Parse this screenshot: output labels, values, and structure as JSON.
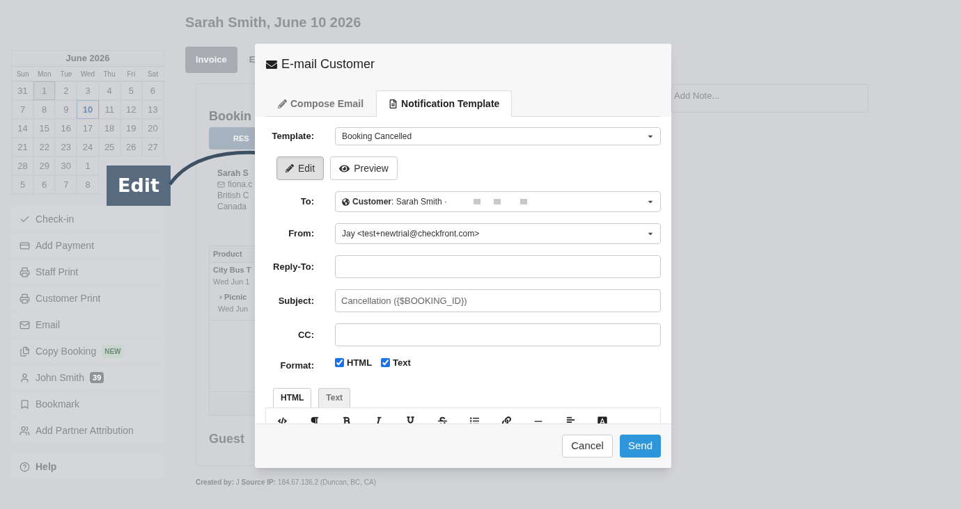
{
  "page": {
    "title": "Sarah Smith, June 10 2026",
    "tabs": [
      {
        "label": "Invoice",
        "selected": true
      },
      {
        "label": "E",
        "selected": false
      }
    ],
    "calendar": {
      "month": "June 2026",
      "weekdays": [
        "Sun",
        "Mon",
        "Tue",
        "Wed",
        "Thu",
        "Fri",
        "Sat"
      ],
      "weeks": [
        [
          {
            "day": "31",
            "selected": false,
            "today": false
          },
          {
            "day": "1",
            "selected": false,
            "today": true
          },
          {
            "day": "2",
            "selected": false,
            "today": false
          },
          {
            "day": "3",
            "selected": false,
            "today": false
          },
          {
            "day": "4",
            "selected": false,
            "today": false
          },
          {
            "day": "5",
            "selected": false,
            "today": false
          },
          {
            "day": "6",
            "selected": false,
            "today": false
          }
        ],
        [
          {
            "day": "7",
            "selected": false,
            "today": false
          },
          {
            "day": "8",
            "selected": false,
            "today": false
          },
          {
            "day": "9",
            "selected": false,
            "today": false
          },
          {
            "day": "10",
            "selected": true,
            "today": false
          },
          {
            "day": "11",
            "selected": false,
            "today": false
          },
          {
            "day": "12",
            "selected": false,
            "today": false
          },
          {
            "day": "13",
            "selected": false,
            "today": false
          }
        ],
        [
          {
            "day": "14",
            "selected": false,
            "today": false
          },
          {
            "day": "15",
            "selected": false,
            "today": false
          },
          {
            "day": "16",
            "selected": false,
            "today": false
          },
          {
            "day": "17",
            "selected": false,
            "today": false
          },
          {
            "day": "18",
            "selected": false,
            "today": false
          },
          {
            "day": "19",
            "selected": false,
            "today": false
          },
          {
            "day": "20",
            "selected": false,
            "today": false
          }
        ],
        [
          {
            "day": "21",
            "selected": false,
            "today": false
          },
          {
            "day": "22",
            "selected": false,
            "today": false
          },
          {
            "day": "23",
            "selected": false,
            "today": false
          },
          {
            "day": "24",
            "selected": false,
            "today": false
          },
          {
            "day": "25",
            "selected": false,
            "today": false
          },
          {
            "day": "26",
            "selected": false,
            "today": false
          },
          {
            "day": "27",
            "selected": false,
            "today": false
          }
        ],
        [
          {
            "day": "28",
            "selected": false,
            "today": false
          },
          {
            "day": "29",
            "selected": false,
            "today": false
          },
          {
            "day": "30",
            "selected": false,
            "today": false
          },
          {
            "day": "1",
            "selected": false,
            "today": false
          }
        ],
        [
          {
            "day": "5",
            "selected": false,
            "today": false
          },
          {
            "day": "6",
            "selected": false,
            "today": false
          },
          {
            "day": "7",
            "selected": false,
            "today": false
          },
          {
            "day": "8",
            "selected": false,
            "today": false
          }
        ]
      ]
    },
    "actions": [
      {
        "label": "Check-in",
        "kind": "check"
      },
      {
        "label": "Add Payment",
        "kind": "payment"
      },
      {
        "label": "Staff Print",
        "kind": "print"
      },
      {
        "label": "Customer Print",
        "kind": "print"
      },
      {
        "label": "Email",
        "kind": "email"
      },
      {
        "label": "Copy Booking",
        "kind": "copy",
        "badge": {
          "text": "NEW",
          "kind": "new"
        }
      },
      {
        "label": "John Smith",
        "kind": "user",
        "badge": {
          "text": "39",
          "kind": "count"
        }
      },
      {
        "label": "Bookmark",
        "kind": "bookmark"
      },
      {
        "label": "Add Partner Attribution",
        "kind": "partners"
      }
    ],
    "help": {
      "label": "Help"
    },
    "booking": {
      "heading": "Bookin",
      "status": "RES",
      "customer": {
        "name": "Sarah S",
        "email": "fiona.c",
        "lines": [
          "British C",
          "Canada"
        ]
      },
      "table": {
        "header": "Product",
        "rows": [
          {
            "title": "City Bus T",
            "date": "Wed Jun 1",
            "children": [
              {
                "title": "Picnic",
                "date": "Wed Jun"
              }
            ]
          }
        ]
      },
      "guest_heading": "Guest"
    },
    "footer": "**Created by:** J **Source IP:** 184.67.136.2 (Duncan, BC, CA)",
    "note": {
      "placeholder": "Add Note..."
    }
  },
  "callout": {
    "label": "Edit"
  },
  "modal": {
    "title": "E-mail Customer",
    "tabs": [
      {
        "label": "Compose Email",
        "kind": "compose",
        "selected": false
      },
      {
        "label": "Notification Template",
        "kind": "template",
        "selected": true
      }
    ],
    "fields": [
      {
        "kind": "select",
        "label": "Template:",
        "value": "Booking Cancelled"
      },
      {
        "kind": "buttons",
        "buttons": [
          {
            "label": "Edit",
            "kind": "edit",
            "selected": true
          },
          {
            "label": "Preview",
            "kind": "preview",
            "selected": false
          }
        ]
      },
      {
        "kind": "recipient",
        "label": "To:",
        "value": "**Customer**: Sarah Smith ·"
      },
      {
        "kind": "select",
        "label": "From:",
        "value": "Jay <test+newtrial@checkfront.com>"
      },
      {
        "kind": "input",
        "label": "Reply-To:"
      },
      {
        "kind": "input",
        "label": "Subject:",
        "value": "Cancellation ({$BOOKING_ID})"
      },
      {
        "kind": "input",
        "label": "CC:"
      },
      {
        "kind": "checkboxes",
        "label": "Format:",
        "options": [
          {
            "label": "HTML",
            "checked": true
          },
          {
            "label": "Text",
            "checked": true
          }
        ]
      }
    ],
    "editor": {
      "tabs": [
        {
          "label": "HTML",
          "selected": true
        },
        {
          "label": "Text",
          "selected": false
        }
      ],
      "toolbar": [
        {
          "kind": "code"
        },
        {
          "kind": "paragraph"
        },
        {
          "kind": "bold"
        },
        {
          "kind": "italic"
        },
        {
          "kind": "underline"
        },
        {
          "kind": "strike"
        },
        {
          "kind": "list"
        },
        {
          "kind": "link"
        },
        {
          "kind": "rule"
        },
        {
          "kind": "align"
        },
        {
          "kind": "color"
        }
      ]
    },
    "buttons": [
      {
        "label": "Cancel",
        "kind": "secondary"
      },
      {
        "label": "Send",
        "kind": "primary"
      }
    ]
  }
}
